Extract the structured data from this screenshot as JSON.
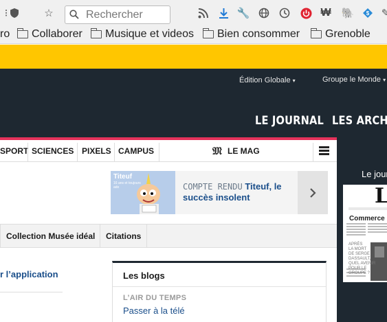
{
  "browser": {
    "search_placeholder": "Rechercher",
    "toolbar_icons": [
      "menu-icon",
      "shield-icon",
      "star-icon",
      "rss-icon",
      "download-icon",
      "wrench-icon",
      "globe-icon",
      "history-icon",
      "power-icon",
      "w-icon",
      "evernote-icon",
      "vpn-icon",
      "pen-icon"
    ]
  },
  "bookmarks": [
    "ro",
    "Collaborer",
    "Musique et videos",
    "Bien consommer",
    "Grenoble"
  ],
  "header": {
    "edition": "Édition Globale",
    "groupe": "Groupe le Monde",
    "nav": [
      "LE JOURNAL",
      "LES ARCHIV"
    ]
  },
  "sections": [
    "SPORT",
    "SCIENCES",
    "PIXELS",
    "CAMPUS"
  ],
  "mag": {
    "logo": "𝔐",
    "label": "LE MAG"
  },
  "card": {
    "kicker": "COMPTE RENDU",
    "title": "Titeuf, le succès insolent",
    "thumb_title": "Titeuf",
    "thumb_sub": "16 ans et toujours ado"
  },
  "subnav": [
    "Collection Musée idéal",
    "Citations"
  ],
  "applink": "r l’application",
  "blogs": {
    "title": "Les blogs",
    "kicker": "L’AIR DU TEMPS",
    "post": "Passer à la télé"
  },
  "journal": {
    "label": "Le jour",
    "cover_headline": "Commerce : les",
    "cover_kicker_lines": [
      "APRÈS",
      "LA MORT",
      "DE SERGE",
      "DASSAULT,",
      "QUEL AVENIR",
      "POUR LE",
      "GROUPE ?"
    ]
  },
  "colors": {
    "banner": "#ffc600",
    "header_bg": "#1e2831",
    "accent_line": "#e5325b",
    "link": "#1a4e8a"
  }
}
